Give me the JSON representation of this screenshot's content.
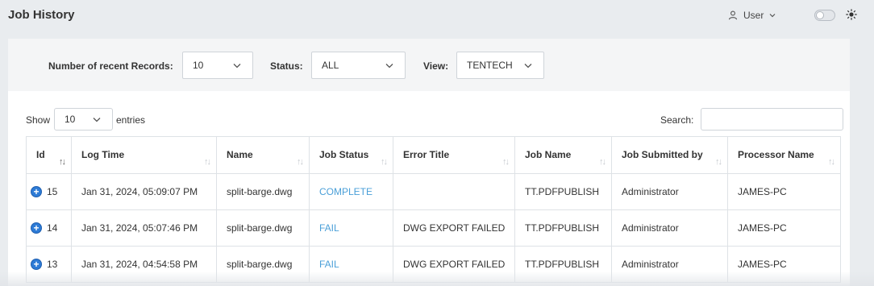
{
  "header": {
    "title": "Job History",
    "user_label": "User",
    "theme_toggle_on": false
  },
  "filters": {
    "records_label": "Number of recent Records:",
    "records_value": "10",
    "status_label": "Status:",
    "status_value": "ALL",
    "view_label": "View:",
    "view_value": "TENTECH"
  },
  "table_controls": {
    "show_label": "Show",
    "entries_value": "10",
    "entries_label": "entries",
    "search_label": "Search:",
    "search_value": ""
  },
  "table": {
    "columns": [
      "Id",
      "Log Time",
      "Name",
      "Job Status",
      "Error Title",
      "Job Name",
      "Job Submitted by",
      "Processor Name"
    ],
    "rows": [
      {
        "id": "15",
        "log_time": "Jan 31, 2024, 05:09:07 PM",
        "name": "split-barge.dwg",
        "job_status": "COMPLETE",
        "error_title": "",
        "job_name": "TT.PDFPUBLISH",
        "submitted_by": "Administrator",
        "processor": "JAMES-PC"
      },
      {
        "id": "14",
        "log_time": "Jan 31, 2024, 05:07:46 PM",
        "name": "split-barge.dwg",
        "job_status": "FAIL",
        "error_title": "DWG EXPORT FAILED",
        "job_name": "TT.PDFPUBLISH",
        "submitted_by": "Administrator",
        "processor": "JAMES-PC"
      },
      {
        "id": "13",
        "log_time": "Jan 31, 2024, 04:54:58 PM",
        "name": "split-barge.dwg",
        "job_status": "FAIL",
        "error_title": "DWG EXPORT FAILED",
        "job_name": "TT.PDFPUBLISH",
        "submitted_by": "Administrator",
        "processor": "JAMES-PC"
      }
    ]
  },
  "colors": {
    "status_link": "#4a9fd8",
    "expand_button": "#2d7bd6",
    "page_background": "#e9ecef"
  },
  "icons": {
    "user": "user-icon",
    "chevron": "chevron-down-icon",
    "theme": "sun-icon",
    "expand": "plus-circle-icon",
    "sort": "sort-icon"
  }
}
